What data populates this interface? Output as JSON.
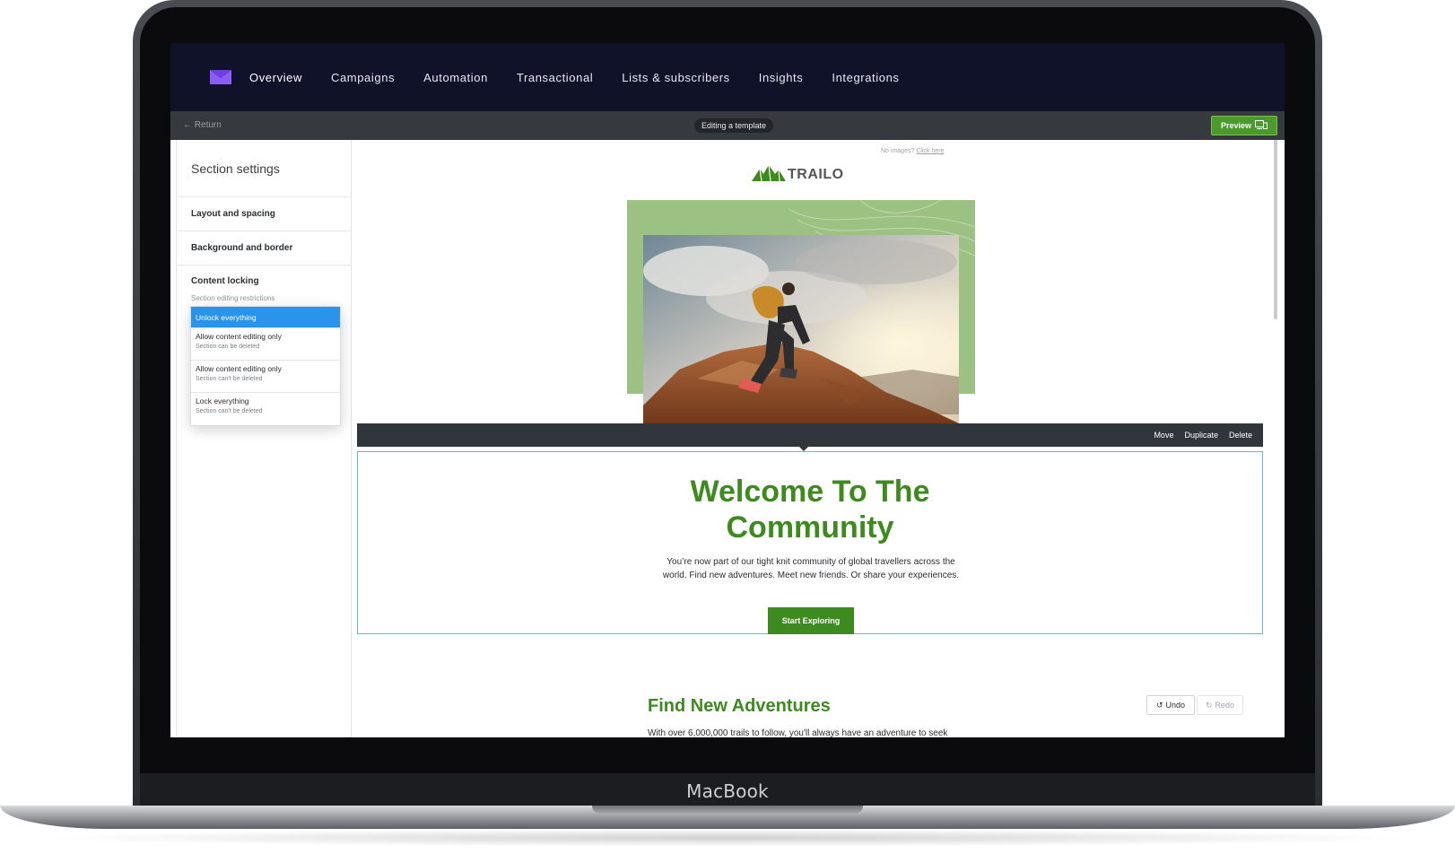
{
  "device": {
    "brand_label": "MacBook"
  },
  "nav": {
    "items": [
      {
        "label": "Overview"
      },
      {
        "label": "Campaigns"
      },
      {
        "label": "Automation"
      },
      {
        "label": "Transactional"
      },
      {
        "label": "Lists & subscribers"
      },
      {
        "label": "Insights"
      },
      {
        "label": "Integrations"
      }
    ],
    "logo_icon": "envelope-logo-icon"
  },
  "subbar": {
    "return_label": "Return",
    "editing_label": "Editing a template",
    "preview_label": "Preview"
  },
  "left_panel": {
    "title": "Section settings",
    "sections": [
      {
        "label": "Layout and spacing"
      },
      {
        "label": "Background and border"
      }
    ],
    "content_locking": {
      "heading": "Content locking",
      "subheading": "Section editing restrictions",
      "options": [
        {
          "label": "Unlock everything",
          "sub": ""
        },
        {
          "label": "Allow content editing only",
          "sub": "Section can be deleted"
        },
        {
          "label": "Allow content editing only",
          "sub": "Section can't be deleted"
        },
        {
          "label": "Lock everything",
          "sub": "Section can't be deleted"
        }
      ]
    }
  },
  "canvas": {
    "no_images_text": "No images?",
    "click_here": "Click here",
    "brand_name": "TRAILO",
    "toolbar": {
      "move": "Move",
      "duplicate": "Duplicate",
      "delete": "Delete"
    },
    "welcome_title": "Welcome To The Community",
    "intro_line1": "You’re now part of our tight knit community of global travellers across the",
    "intro_line2": "world. Find new adventures. Meet new friends. Or share your experiences.",
    "cta_label": "Start Exploring",
    "adventures_heading": "Find New Adventures",
    "adventures_text": "With over 6,000,000 trails to follow, you'll always have an adventure to seek",
    "undo_label": "Undo",
    "redo_label": "Redo"
  },
  "colors": {
    "nav_bg": "#10122a",
    "accent_green": "#3d8a1f",
    "selection_blue": "#2a94ec",
    "hero_green": "#9cc283"
  }
}
